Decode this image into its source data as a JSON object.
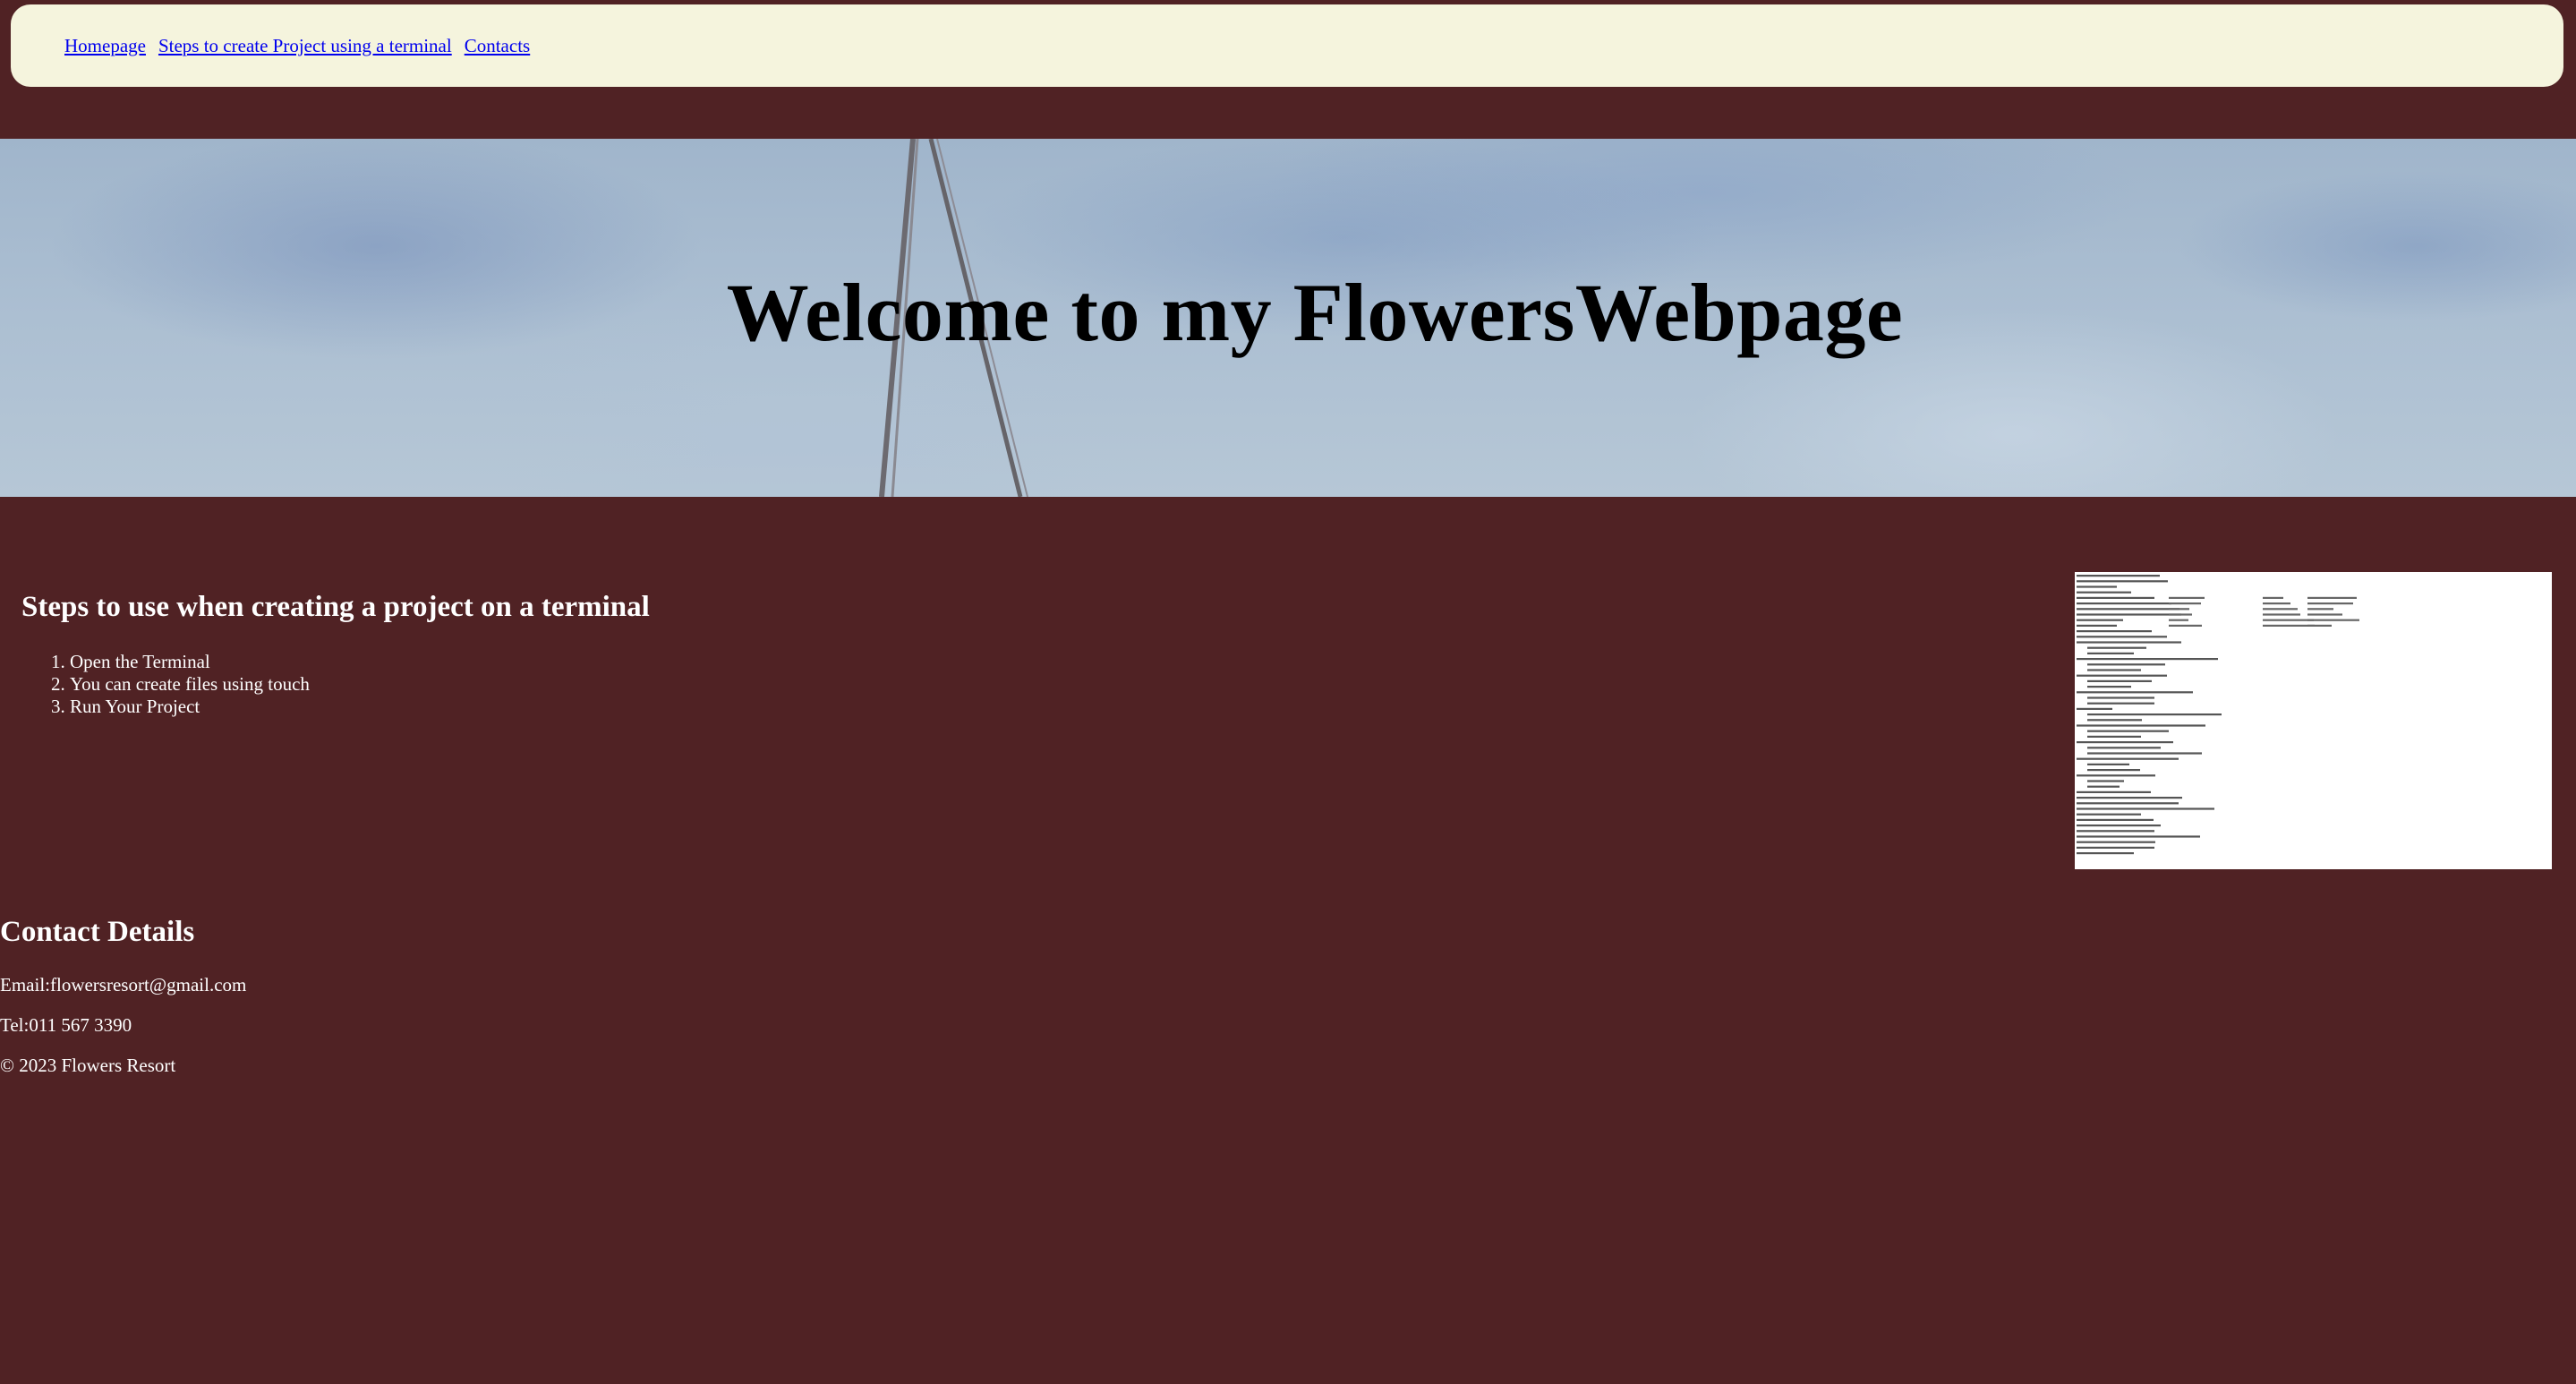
{
  "nav": {
    "links": [
      "Homepage",
      "Steps to create Project using a terminal",
      "Contacts"
    ]
  },
  "hero": {
    "title": "Welcome to my FlowersWebpage"
  },
  "steps": {
    "heading": "Steps to use when creating a project on a terminal",
    "items": [
      "Open the Terminal",
      "You can create files using touch",
      "Run Your Project"
    ]
  },
  "contact": {
    "heading": "Contact Details",
    "email": "Email:flowersresort@gmail.com",
    "tel": "Tel:011 567 3390",
    "copyright": "© 2023 Flowers Resort"
  },
  "colors": {
    "page_background": "#502224",
    "nav_background": "#f5f4dd",
    "link": "#0000ee",
    "hero_sky": "#a9bdd1"
  }
}
